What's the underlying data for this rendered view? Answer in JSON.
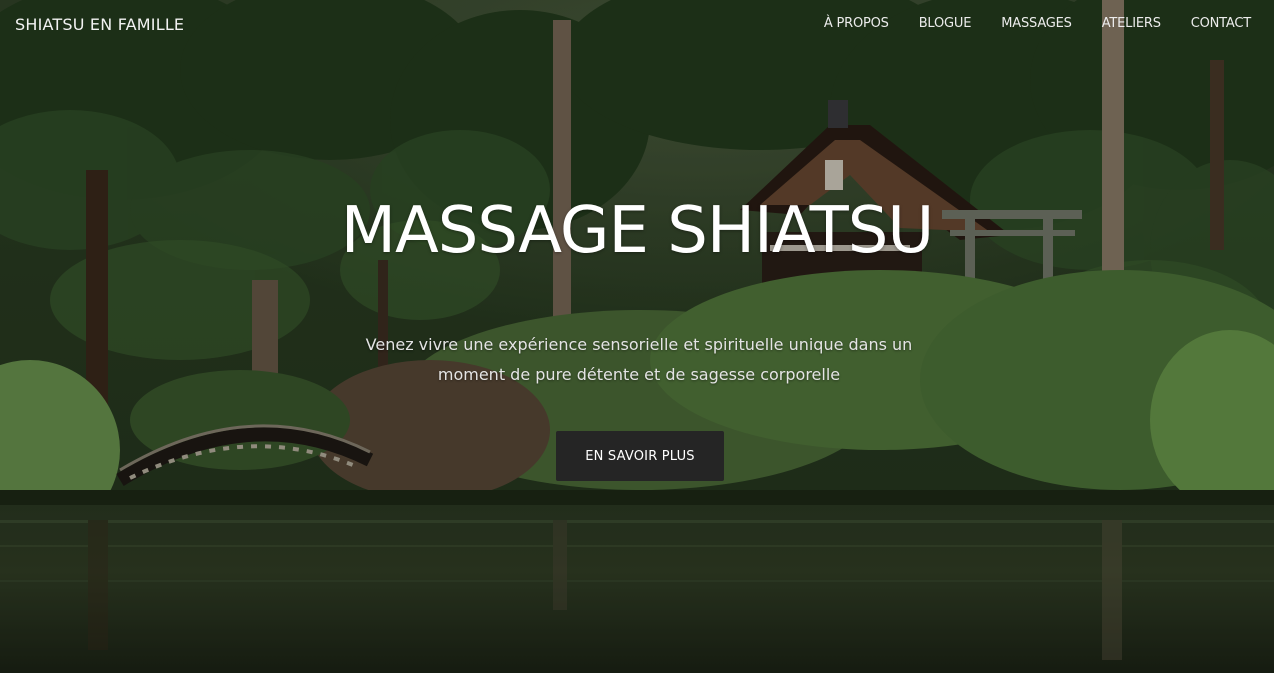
{
  "nav": {
    "brand": "SHIATSU EN FAMILLE",
    "links": [
      "À PROPOS",
      "BLOGUE",
      "MASSAGES",
      "ATELIERS",
      "CONTACT"
    ]
  },
  "hero": {
    "title": "MASSAGE SHIATSU",
    "subtitle": "Venez vivre une expérience sensorielle et spirituelle unique dans un moment de pure détente et de sagesse corporelle",
    "cta_label": "EN SAVOIR PLUS",
    "background_image": "japanese-garden-photo"
  },
  "colors": {
    "button_bg": "#252525",
    "text": "#ffffff",
    "foliage": "#2f4a25",
    "water": "#26301f"
  }
}
